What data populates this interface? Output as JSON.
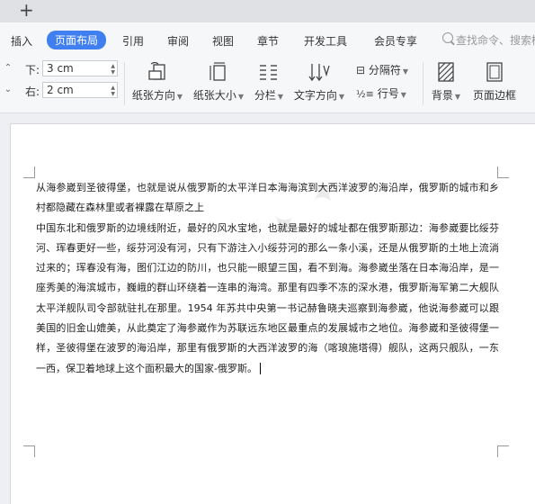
{
  "tab_strip": {
    "new_tab": "+"
  },
  "menu": {
    "items": [
      "插入",
      "页面布局",
      "引用",
      "审阅",
      "视图",
      "章节",
      "开发工具",
      "会员专享"
    ],
    "active_index": 1,
    "search_placeholder": "查找命令、搜索模"
  },
  "ribbon": {
    "bottom_margin": {
      "label": "下:",
      "value": "3 cm"
    },
    "right_margin": {
      "label": "右:",
      "value": "2 cm"
    },
    "paper_orientation": "纸张方向",
    "paper_size": "纸张大小",
    "columns": "分栏",
    "text_direction": "文字方向",
    "separator": "分隔符",
    "line_numbers": "行号",
    "background": "背景",
    "page_border": "页面边框"
  },
  "document": {
    "paragraphs": [
      "从海参崴到圣彼得堡，也就是说从俄罗斯的太平洋日本海海滨到大西洋波罗的海沿岸，俄罗斯的城市和乡村都隐藏在森林里或者裸露在草原之上",
      "中国东北和俄罗斯的边境线附近，最好的风水宝地，也就是最好的城址都在俄罗斯那边：海参崴要比绥芬河、珲春更好一些，绥芬河没有河，只有下游注入小绥芬河的那么一条小溪，还是从俄罗斯的土地上流淌过来的；珲春没有海，图们江边的防川，也只能一眼望三国，看不到海。海参崴坐落在日本海沿岸，是一座秀美的海滨城市，巍峨的群山环绕着一连串的海湾。那里有四季不冻的深水港，俄罗斯海军第二大舰队太平洋舰队司令部就驻扎在那里。1954 年苏共中央第一书记赫鲁晓夫巡察到海参崴，他说海参崴可以跟美国的旧金山媲美，从此奠定了海参崴作为苏联远东地区最重点的发展城市之地位。海参崴和圣彼得堡一样，圣彼得堡在波罗的海沿岸，那里有俄罗斯的大西洋波罗的海（喀琅施塔得）舰队，这两只舰队，一东一西，保卫着地球上这个面积最大的国家-俄罗斯。"
    ]
  }
}
